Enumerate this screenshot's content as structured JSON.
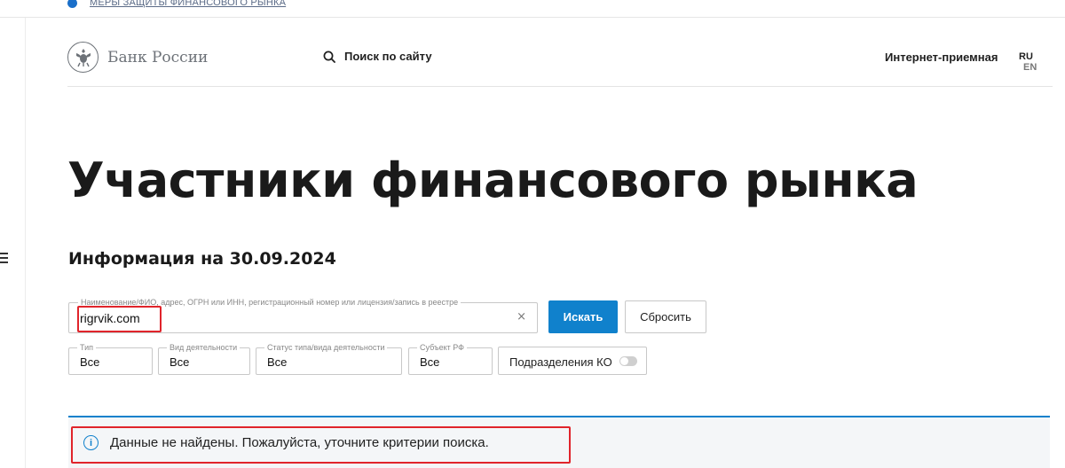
{
  "top_bar": {
    "link": "МЕРЫ ЗАЩИТЫ ФИНАНСОВОГО РЫНКА"
  },
  "header": {
    "logo_text": "Банк России",
    "site_search_label": "Поиск по сайту",
    "reception": "Интернет-приемная",
    "lang_active": "RU",
    "lang_other": "EN"
  },
  "page": {
    "title": "Участники финансового рынка",
    "info_date": "Информация на 30.09.2024"
  },
  "search": {
    "label": "Наименование/ФИО, адрес, ОГРН или ИНН, регистрационный номер или лицензия/запись в реестре",
    "value": "rigrvik.com",
    "clear": "×",
    "search_button": "Искать",
    "reset_button": "Сбросить"
  },
  "filters": [
    {
      "label": "Тип",
      "value": "Все"
    },
    {
      "label": "Вид деятельности",
      "value": "Все"
    },
    {
      "label": "Статус типа/вида деятельности",
      "value": "Все"
    },
    {
      "label": "Субъект РФ",
      "value": "Все"
    }
  ],
  "toggle": {
    "label": "Подразделения КО",
    "on": false
  },
  "result": {
    "message": "Данные не найдены. Пожалуйста, уточните критерии поиска.",
    "icon_glyph": "i"
  },
  "colors": {
    "accent": "#1081cc",
    "annotation": "#e0242b"
  },
  "icons": [
    "info-icon",
    "bank-emblem-icon",
    "search-icon",
    "close-icon",
    "menu-icon"
  ]
}
